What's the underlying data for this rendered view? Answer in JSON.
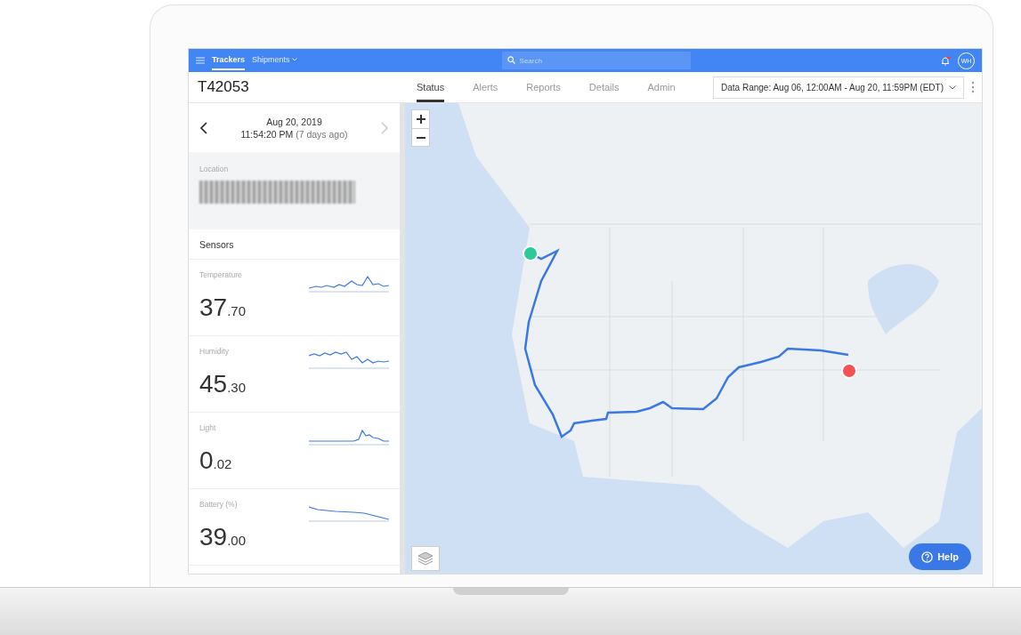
{
  "nav": {
    "items": [
      {
        "label": "Trackers",
        "selected": true,
        "dropdown": false
      },
      {
        "label": "Shipments",
        "selected": false,
        "dropdown": true
      }
    ],
    "search": {
      "placeholder": "Search"
    },
    "notification": true,
    "user_initials": "WH"
  },
  "header": {
    "title": "T42053",
    "tabs": [
      {
        "label": "Status",
        "selected": true
      },
      {
        "label": "Alerts",
        "selected": false
      },
      {
        "label": "Reports",
        "selected": false
      },
      {
        "label": "Details",
        "selected": false
      },
      {
        "label": "Admin",
        "selected": false
      }
    ],
    "data_range": "Data Range: Aug 06, 12:00AM - Aug 20, 11:59PM (EDT)"
  },
  "sidebar": {
    "date": "Aug 20, 2019",
    "time": "11:54:20 PM",
    "relative": "(7 days ago)",
    "next_disabled": true,
    "location_label": "Location",
    "sensors_title": "Sensors",
    "sensors": [
      {
        "name": "Temperature",
        "whole": "37",
        "decimal": ".70",
        "kind": "noisy"
      },
      {
        "name": "Humidity",
        "whole": "45",
        "decimal": ".30",
        "kind": "dip"
      },
      {
        "name": "Light",
        "whole": "0",
        "decimal": ".02",
        "kind": "spike"
      },
      {
        "name": "Battery (%)",
        "whole": "39",
        "decimal": ".00",
        "kind": "decline"
      }
    ]
  },
  "map": {
    "help": "Help"
  }
}
